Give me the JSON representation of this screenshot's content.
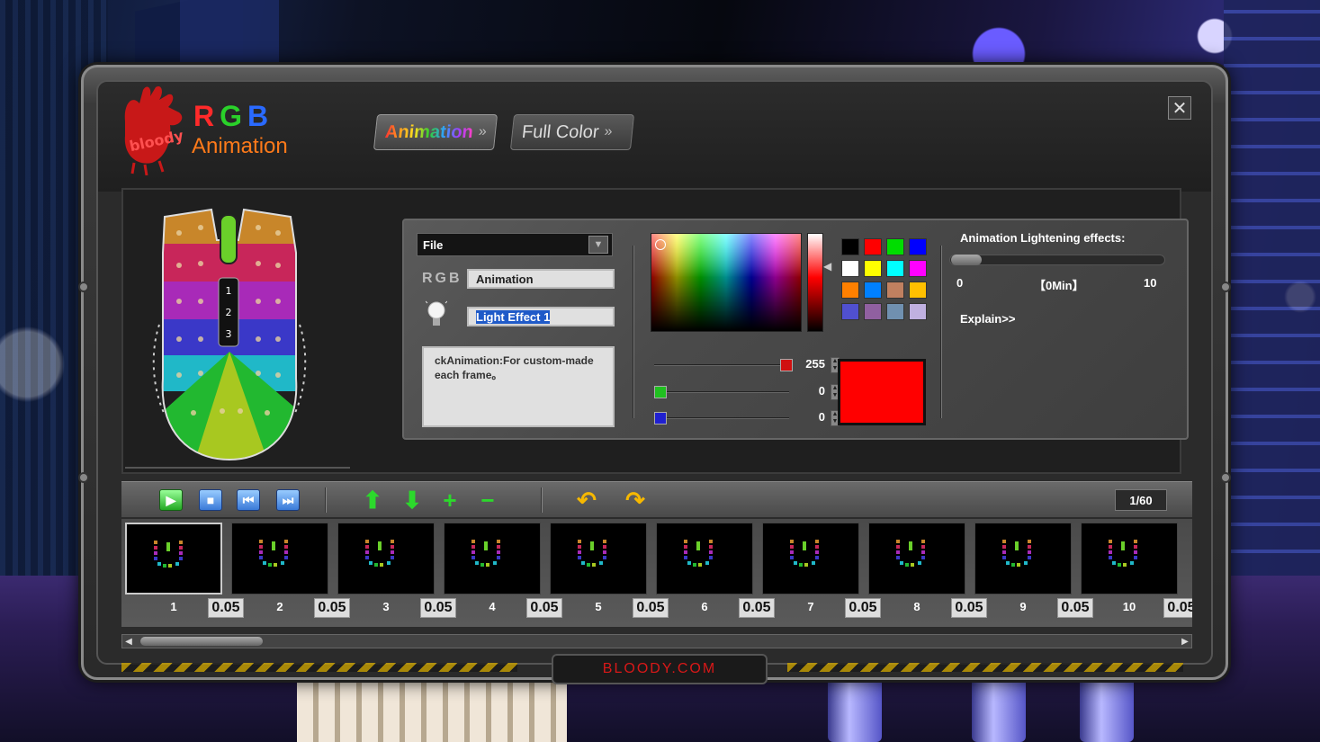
{
  "app": {
    "logo_text": "bloody",
    "logo_rgb": [
      "R",
      "G",
      "B"
    ],
    "logo_subtitle": "Animation"
  },
  "tabs": [
    {
      "label": "Animation",
      "active": true
    },
    {
      "label": "Full Color",
      "active": false
    }
  ],
  "window": {
    "close_label": "✕"
  },
  "editor": {
    "file_label": "File",
    "rgb_label": "RGB",
    "name_value": "Animation",
    "effect_value": "Light Effect 1",
    "description": "ckAnimation:For custom-made each frame。"
  },
  "color": {
    "swatches": [
      "#000000",
      "#ff0000",
      "#00dd00",
      "#0000ff",
      "#ffffff",
      "#ffff00",
      "#00ffff",
      "#ff00ff",
      "#ff8000",
      "#0080ff",
      "#c08060",
      "#ffc000",
      "#5050d0",
      "#9060a0",
      "#7090b0",
      "#c0b0e0"
    ],
    "red": "255",
    "green": "0",
    "blue": "0",
    "preview_hex": "#ff0000"
  },
  "animation_effects": {
    "title": "Animation Lightening effects:",
    "min": "0",
    "value_label": "【0Min】",
    "max": "10",
    "level": 0,
    "explain": "Explain>>"
  },
  "toolbar": {
    "counter": "1/60"
  },
  "frames": [
    {
      "num": "1",
      "dur": "0.05"
    },
    {
      "num": "2",
      "dur": "0.05"
    },
    {
      "num": "3",
      "dur": "0.05"
    },
    {
      "num": "4",
      "dur": "0.05"
    },
    {
      "num": "5",
      "dur": "0.05"
    },
    {
      "num": "6",
      "dur": "0.05"
    },
    {
      "num": "7",
      "dur": "0.05"
    },
    {
      "num": "8",
      "dur": "0.05"
    },
    {
      "num": "9",
      "dur": "0.05"
    },
    {
      "num": "10",
      "dur": "0.05"
    }
  ],
  "footer": {
    "brand": "BLOODY.COM"
  }
}
